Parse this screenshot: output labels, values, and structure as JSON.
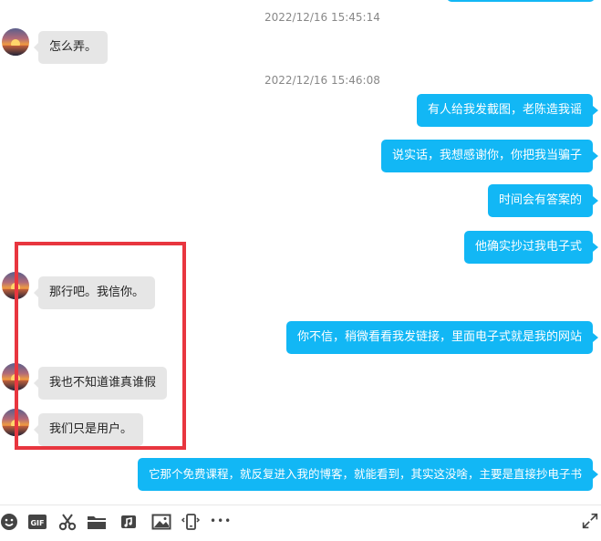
{
  "chat": {
    "timestamps": [
      "2022/12/16 15:45:14",
      "2022/12/16 15:46:08"
    ],
    "messages": [
      {
        "side": "in",
        "text": "怎么弄。"
      },
      {
        "side": "out",
        "text": "有人给我发截图，老陈造我谣"
      },
      {
        "side": "out",
        "text": "说实话，我想感谢你，你把我当骗子"
      },
      {
        "side": "out",
        "text": "时间会有答案的"
      },
      {
        "side": "out",
        "text": "他确实抄过我电子式"
      },
      {
        "side": "in",
        "text": "那行吧。我信你。"
      },
      {
        "side": "out",
        "text": "你不信，稍微看看我发链接，里面电子式就是我的网站"
      },
      {
        "side": "in",
        "text": "我也不知道谁真谁假"
      },
      {
        "side": "in",
        "text": "我们只是用户。"
      },
      {
        "side": "out",
        "text": "它那个免费课程，就反复进入我的博客，就能看到，其实这没啥，主要是直接抄电子书"
      }
    ]
  },
  "toolbar": {
    "gif_label": "GIF",
    "more_label": "•••",
    "icons": [
      "emoji-icon",
      "gif-icon",
      "scissors-icon",
      "folder-icon",
      "music-icon",
      "image-icon",
      "shake-icon",
      "more-icon",
      "expand-icon"
    ]
  },
  "colors": {
    "outgoing_bubble": "#12b7f5",
    "incoming_bubble": "#e6e6e6",
    "highlight": "#e8363f"
  }
}
